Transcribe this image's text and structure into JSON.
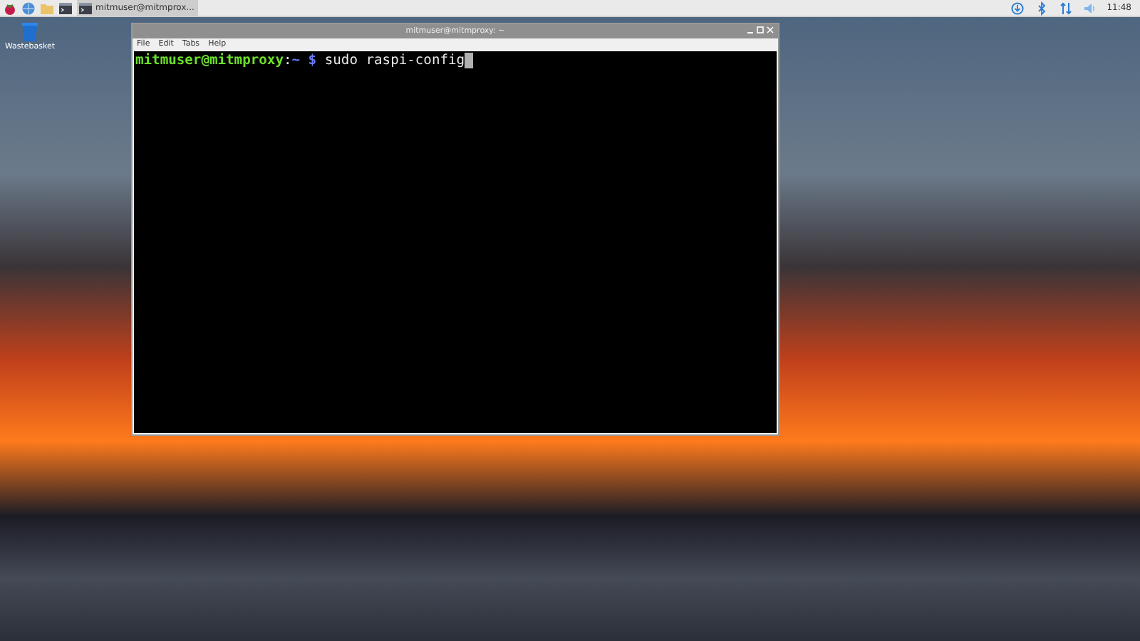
{
  "taskbar": {
    "launchers": [
      {
        "kind": "menu"
      },
      {
        "kind": "browser"
      },
      {
        "kind": "files"
      },
      {
        "kind": "terminal"
      }
    ],
    "tasks": [
      {
        "label": "mitmuser@mitmprox...",
        "selected": true
      }
    ],
    "tray": {
      "clock": "11:48"
    }
  },
  "desktop": {
    "icons": [
      {
        "label": "Wastebasket"
      }
    ]
  },
  "window": {
    "title": "mitmuser@mitmproxy: ~",
    "menu": [
      "File",
      "Edit",
      "Tabs",
      "Help"
    ],
    "terminal": {
      "segments": [
        {
          "kind": "user",
          "text": "mitmuser@mitmproxy"
        },
        {
          "kind": "plain",
          "text": ":"
        },
        {
          "kind": "path",
          "text": "~"
        },
        {
          "kind": "path",
          "text": " $"
        },
        {
          "kind": "plain",
          "text": " sudo raspi-config"
        }
      ],
      "cursor": true
    }
  }
}
